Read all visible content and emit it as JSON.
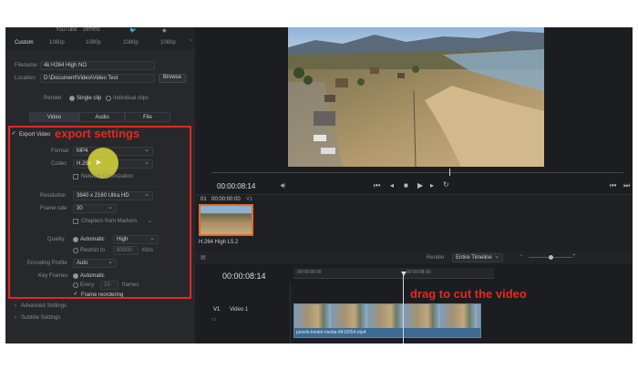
{
  "presets": {
    "items": [
      {
        "label": "Custom"
      },
      {
        "label": "1080p"
      },
      {
        "label": "1080p"
      },
      {
        "label": "1080p"
      },
      {
        "label": "1080p"
      }
    ],
    "top_logos": [
      "YouTube",
      "vimeo",
      "Twitter",
      "Dropbox"
    ]
  },
  "export": {
    "filename_label": "Filename",
    "filename_value": "4k H264 High NO",
    "location_label": "Location",
    "location_value": "D:\\Document\\Video\\Video Test",
    "browse_label": "Browse",
    "render_label": "Render",
    "single_clip_label": "Single clip",
    "individual_clips_label": "Individual clips",
    "tabs": [
      {
        "label": "Video"
      },
      {
        "label": "Audio"
      },
      {
        "label": "File"
      }
    ],
    "export_video_label": "Export Video",
    "format_label": "Format",
    "format_value": "MP4",
    "codec_label": "Codec",
    "codec_value": "H.264",
    "network_opt_label": "Network Optimization",
    "resolution_label": "Resolution",
    "resolution_value": "3840 x 2160 Ultra HD",
    "frame_rate_label": "Frame rate",
    "frame_rate_value": "30",
    "chapters_label": "Chapters from Markers",
    "quality_label": "Quality",
    "automatic_label": "Automatic",
    "quality_value": "High",
    "restrict_label": "Restrict to",
    "restrict_value": "80000",
    "restrict_unit": "Kb/s",
    "encoding_label": "Encoding Profile",
    "encoding_value": "Auto",
    "keyframes_label": "Key Frames",
    "keyframes_auto": "Automatic",
    "every_label": "Every",
    "every_value": "10",
    "every_unit": "frames",
    "frame_reorder_label": "Frame reordering",
    "advanced_label": "Advanced Settings",
    "subtitle_label": "Subtitle Settings"
  },
  "viewer": {
    "timecode": "00:00:08:14"
  },
  "clip_strip": {
    "index": "01",
    "timecode": "00:00:00:00",
    "track": "V1",
    "clip_name": "H.264 High L5.2"
  },
  "timeline": {
    "render_label": "Render",
    "render_value": "Entire Timeline",
    "timecode": "00:00:08:14",
    "ruler_labels": [
      "00:00:00:00",
      "00:00:08:00"
    ],
    "track_id": "V1",
    "track_name": "Video 1",
    "clip_filename": "pexels-kindel-media-8410054.mp4"
  },
  "annotations": {
    "export_settings": "export settings",
    "drag_to_cut": "drag to cut the video"
  },
  "colors": {
    "annotation_red": "#e8271f",
    "highlight_yellow": "#f1ef3a",
    "clip_blue": "#3d6b92",
    "playhead": "#d8d8d8"
  }
}
